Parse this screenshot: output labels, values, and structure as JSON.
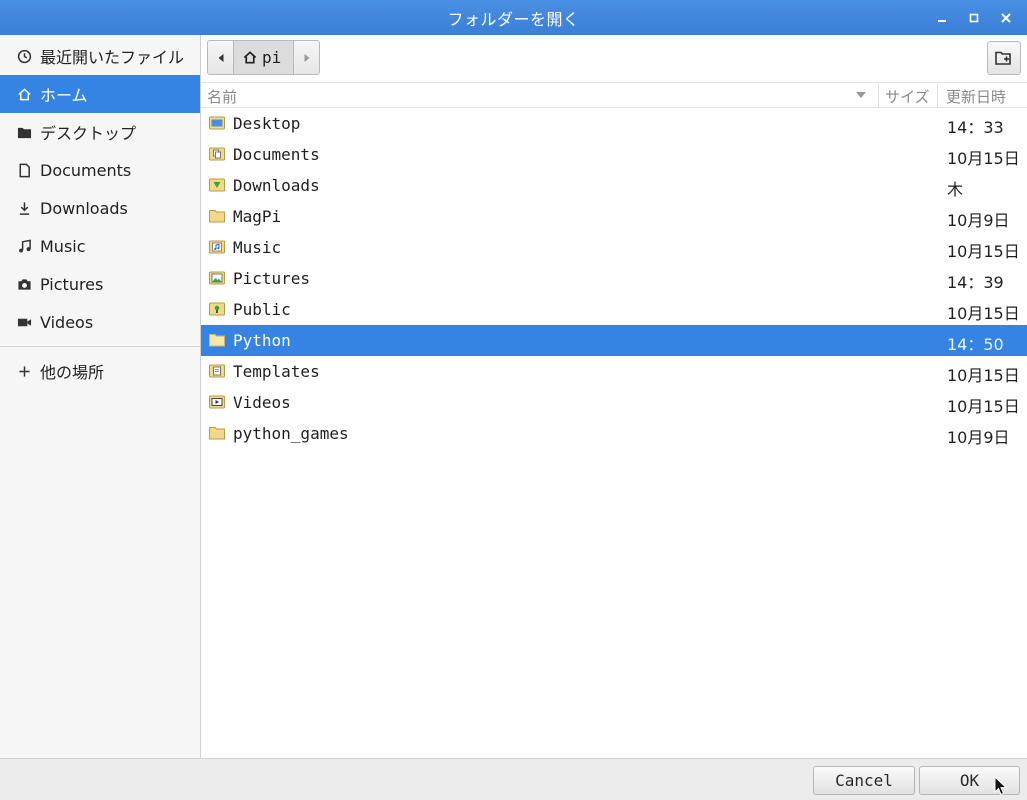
{
  "window": {
    "title": "フォルダーを開く"
  },
  "sidebar": {
    "items": [
      {
        "label": "最近開いたファイル",
        "icon": "clock-icon"
      },
      {
        "label": "ホーム",
        "icon": "home-icon",
        "active": true
      },
      {
        "label": "デスクトップ",
        "icon": "desktop-folder-icon"
      },
      {
        "label": "Documents",
        "icon": "document-icon"
      },
      {
        "label": "Downloads",
        "icon": "download-icon"
      },
      {
        "label": "Music",
        "icon": "music-note-icon"
      },
      {
        "label": "Pictures",
        "icon": "camera-icon"
      },
      {
        "label": "Videos",
        "icon": "video-camera-icon"
      }
    ],
    "other_locations": {
      "label": "他の場所",
      "icon": "plus-icon"
    }
  },
  "pathbar": {
    "crumb": "pi"
  },
  "columns": {
    "name": "名前",
    "size": "サイズ",
    "modified": "更新日時"
  },
  "files": [
    {
      "name": "Desktop",
      "modified": "14：33",
      "icon": "desktop-folder-icon"
    },
    {
      "name": "Documents",
      "modified": "10月15日",
      "icon": "documents-folder-icon"
    },
    {
      "name": "Downloads",
      "modified": "木",
      "icon": "downloads-folder-icon"
    },
    {
      "name": "MagPi",
      "modified": "10月9日",
      "icon": "folder-icon"
    },
    {
      "name": "Music",
      "modified": "10月15日",
      "icon": "music-folder-icon"
    },
    {
      "name": "Pictures",
      "modified": "14：39",
      "icon": "pictures-folder-icon"
    },
    {
      "name": "Public",
      "modified": "10月15日",
      "icon": "public-folder-icon"
    },
    {
      "name": "Python",
      "modified": "14：50",
      "icon": "folder-icon",
      "selected": true
    },
    {
      "name": "Templates",
      "modified": "10月15日",
      "icon": "templates-folder-icon"
    },
    {
      "name": "Videos",
      "modified": "10月15日",
      "icon": "videos-folder-icon"
    },
    {
      "name": "python_games",
      "modified": "10月9日",
      "icon": "folder-icon"
    }
  ],
  "buttons": {
    "cancel": "Cancel",
    "ok": "OK"
  },
  "colors": {
    "accent": "#3584e4",
    "titlebar": "#3a7fd6",
    "folder": "#f2d98a"
  }
}
